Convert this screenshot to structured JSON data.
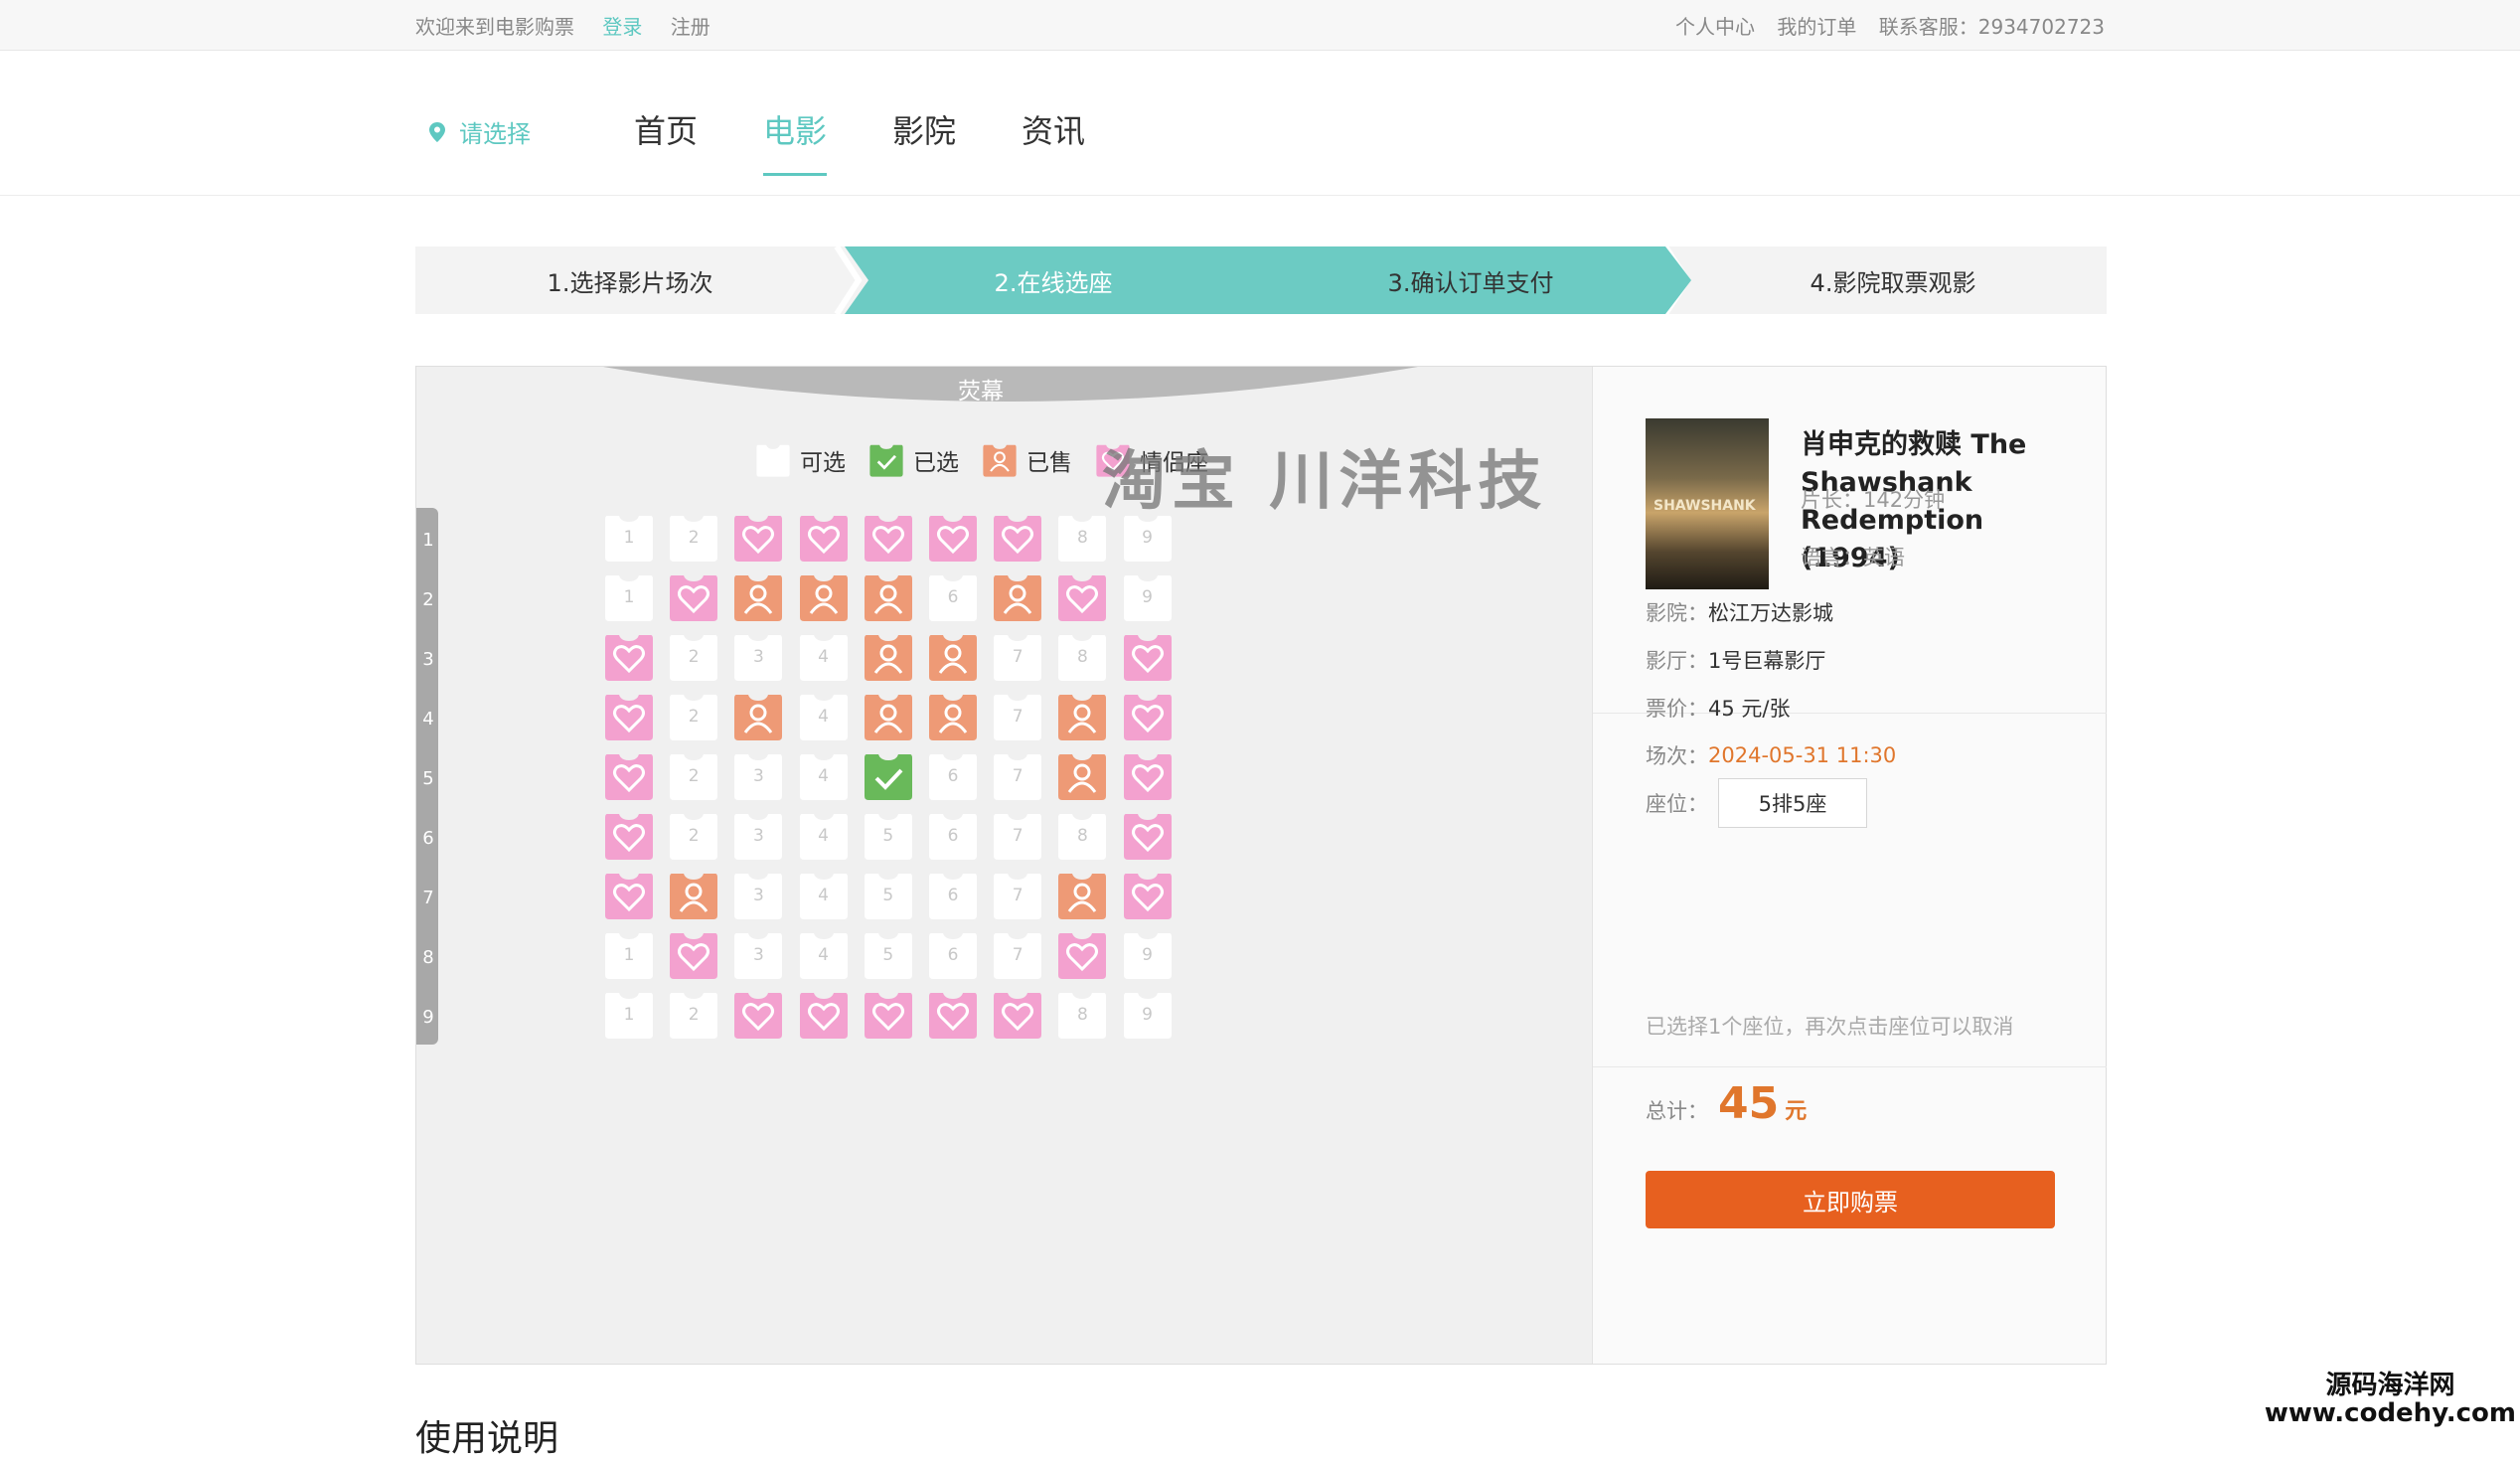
{
  "topbar": {
    "welcome": "欢迎来到电影购票",
    "login": "登录",
    "register": "注册",
    "user_center": "个人中心",
    "my_orders": "我的订单",
    "service": "联系客服：2934702723"
  },
  "header": {
    "city": "请选择",
    "nav": [
      "首页",
      "电影",
      "影院",
      "资讯"
    ],
    "active_nav": "电影"
  },
  "steps": [
    "1.选择影片场次",
    "2.在线选座",
    "3.确认订单支付",
    "4.影院取票观影"
  ],
  "active_step": 1,
  "hall": {
    "screen": "荧幕",
    "legend": {
      "available": "可选",
      "selected": "已选",
      "sold": "已售",
      "couple": "情侣座"
    },
    "rows": [
      "1",
      "2",
      "3",
      "4",
      "5",
      "6",
      "7",
      "8",
      "9"
    ],
    "seat_map": [
      [
        "a",
        "a",
        "c",
        "c",
        "c",
        "c",
        "c",
        "a",
        "a"
      ],
      [
        "a",
        "c",
        "s",
        "s",
        "s",
        "a",
        "s",
        "c",
        "a"
      ],
      [
        "c",
        "a",
        "a",
        "a",
        "s",
        "s",
        "a",
        "a",
        "c"
      ],
      [
        "c",
        "a",
        "s",
        "a",
        "s",
        "s",
        "a",
        "s",
        "c"
      ],
      [
        "c",
        "a",
        "a",
        "a",
        "x",
        "a",
        "a",
        "s",
        "c"
      ],
      [
        "c",
        "a",
        "a",
        "a",
        "a",
        "a",
        "a",
        "a",
        "c"
      ],
      [
        "c",
        "s",
        "a",
        "a",
        "a",
        "a",
        "a",
        "s",
        "c"
      ],
      [
        "a",
        "c",
        "a",
        "a",
        "a",
        "a",
        "a",
        "c",
        "a"
      ],
      [
        "a",
        "a",
        "c",
        "c",
        "c",
        "c",
        "c",
        "a",
        "a"
      ]
    ],
    "seat_legend_codes": {
      "a": "available",
      "x": "selected",
      "s": "sold",
      "c": "couple"
    },
    "watermark": "淘宝 川洋科技"
  },
  "colors": {
    "accent": "#5ec8c1",
    "sold": "#ee9a76",
    "couple": "#f3a1cf",
    "selected": "#69b95a",
    "buy": "#e7601f",
    "price": "#e0762c"
  },
  "movie": {
    "title": "肖申克的救赎 The Shawshank Redemption (1994)",
    "duration_label": "片长：",
    "duration": "142分钟",
    "language_label": "语言：",
    "language": "英语",
    "poster_text": "SHAWSHANK"
  },
  "order": {
    "cinema_label": "影院：",
    "cinema": "松江万达影城",
    "hall_label": "影厅：",
    "hall": "1号巨幕影厅",
    "price_label": "票价：",
    "price": "45 元/张",
    "session_label": "场次：",
    "session": "2024-05-31 11:30",
    "seat_label": "座位：",
    "seat": "5排5座",
    "hint": "已选择1个座位，再次点击座位可以取消",
    "total_label": "总计：",
    "total": "45",
    "total_unit": "元",
    "buy_button": "立即购票"
  },
  "footer": {
    "usage_title": "使用说明",
    "corner_line1": "源码海洋网",
    "corner_line2": "www.codehy.com"
  }
}
